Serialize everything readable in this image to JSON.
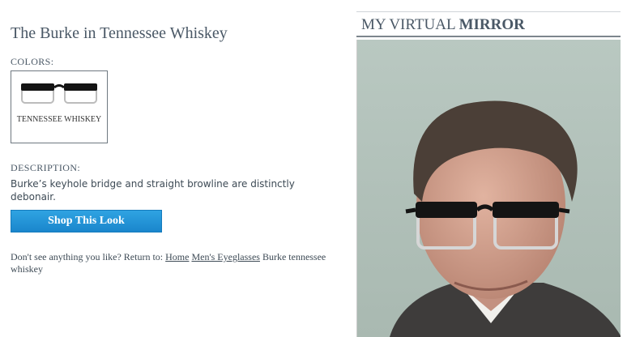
{
  "product": {
    "title": "The Burke in Tennessee Whiskey",
    "colors_label": "COLORS:",
    "swatch": {
      "name": "TENNESSEE WHISKEY",
      "selected": true
    },
    "description_label": "DESCRIPTION:",
    "description": "Burke’s keyhole bridge and straight browline are distinctly debonair.",
    "shop_button": "Shop This Look"
  },
  "return_nav": {
    "prefix": "Don't see anything you like? Return to:",
    "link_home": "Home",
    "link_mens": "Men's Eyeglasses",
    "current": "Burke tennessee whiskey"
  },
  "mirror": {
    "heading_regular": "MY VIRTUAL",
    "heading_bold": "MIRROR"
  },
  "colors": {
    "accent": "#1a86cc",
    "text": "#3d4a55",
    "rule": "#7d868d"
  }
}
